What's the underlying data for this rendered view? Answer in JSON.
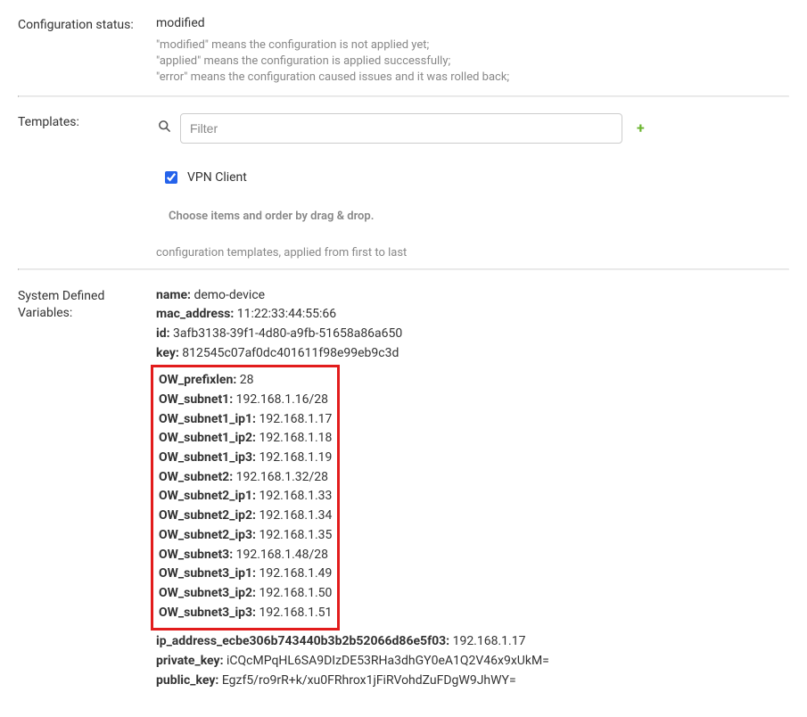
{
  "config_status": {
    "label": "Configuration status:",
    "value": "modified",
    "help1": "\"modified\" means the configuration is not applied yet;",
    "help2": "\"applied\" means the configuration is applied successfully;",
    "help3": "\"error\" means the configuration caused issues and it was rolled back;"
  },
  "templates": {
    "label": "Templates:",
    "filter_placeholder": "Filter",
    "item1_label": "VPN Client",
    "item1_checked": true,
    "choose_hint": "Choose items and order by drag & drop.",
    "applied_hint": "configuration templates, applied from first to last"
  },
  "sys_vars": {
    "label": "System Defined Variables:",
    "top": [
      {
        "k": "name:",
        "v": "demo-device"
      },
      {
        "k": "mac_address:",
        "v": "11:22:33:44:55:66"
      },
      {
        "k": "id:",
        "v": "3afb3138-39f1-4d80-a9fb-51658a86a650"
      },
      {
        "k": "key:",
        "v": "812545c07af0dc401611f98e99eb9c3d"
      }
    ],
    "boxed": [
      {
        "k": "OW_prefixlen:",
        "v": "28"
      },
      {
        "k": "OW_subnet1:",
        "v": "192.168.1.16/28"
      },
      {
        "k": "OW_subnet1_ip1:",
        "v": "192.168.1.17"
      },
      {
        "k": "OW_subnet1_ip2:",
        "v": "192.168.1.18"
      },
      {
        "k": "OW_subnet1_ip3:",
        "v": "192.168.1.19"
      },
      {
        "k": "OW_subnet2:",
        "v": "192.168.1.32/28"
      },
      {
        "k": "OW_subnet2_ip1:",
        "v": "192.168.1.33"
      },
      {
        "k": "OW_subnet2_ip2:",
        "v": "192.168.1.34"
      },
      {
        "k": "OW_subnet2_ip3:",
        "v": "192.168.1.35"
      },
      {
        "k": "OW_subnet3:",
        "v": "192.168.1.48/28"
      },
      {
        "k": "OW_subnet3_ip1:",
        "v": "192.168.1.49"
      },
      {
        "k": "OW_subnet3_ip2:",
        "v": "192.168.1.50"
      },
      {
        "k": "OW_subnet3_ip3:",
        "v": "192.168.1.51"
      }
    ],
    "bottom": [
      {
        "k": "ip_address_ecbe306b743440b3b2b52066d86e5f03:",
        "v": "192.168.1.17"
      },
      {
        "k": "private_key:",
        "v": "iCQcMPqHL6SA9DIzDE53RHa3dhGY0eA1Q2V46x9xUkM="
      },
      {
        "k": "public_key:",
        "v": "Egzf5/ro9rR+k/xu0FRhrox1jFiRVohdZuFDgW9JhWY="
      }
    ]
  }
}
